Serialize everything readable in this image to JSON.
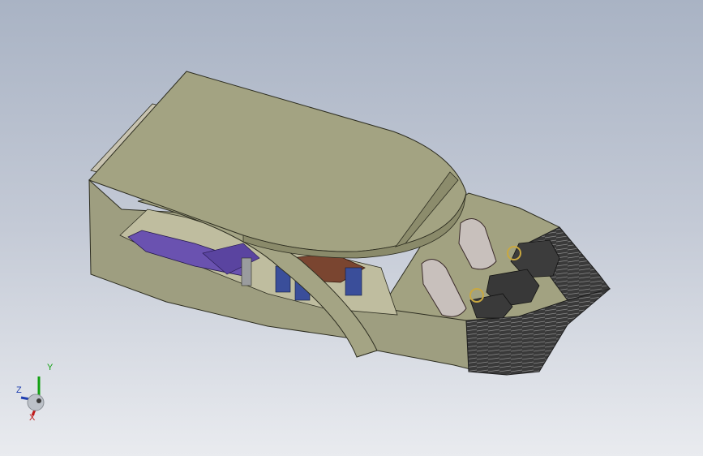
{
  "viewport": {
    "colors": {
      "background_top": "#a9b3c4",
      "background_bottom": "#e9ebef",
      "hull": "#9a9a7a",
      "roof": "#a3a382",
      "deck_dark": "#3a3a3a",
      "interior_purple": "#6a52b0",
      "interior_wood": "#7a4530",
      "chair_blue": "#3a4e9a"
    }
  },
  "triad": {
    "y_label": "Y",
    "z_label": "Z",
    "x_label": "X",
    "colors": {
      "y": "#12a012",
      "z": "#1f3fb0",
      "x": "#c01818"
    }
  }
}
